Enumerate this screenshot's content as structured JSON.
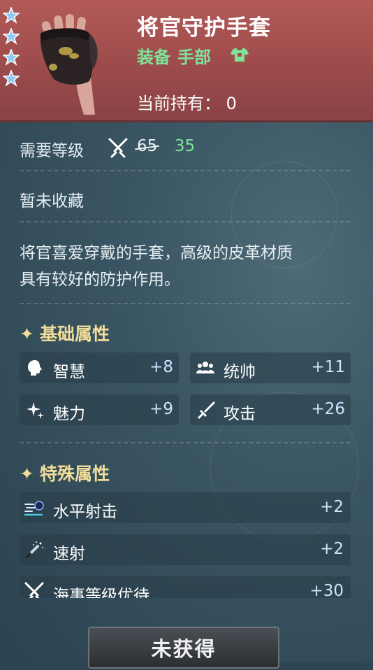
{
  "item": {
    "name": "将官守护手套",
    "category_label": "装备",
    "slot_label": "手部",
    "owned_label": "当前持有：",
    "owned_count": "0",
    "stars": 4,
    "colors": {
      "header": "#a24e4e",
      "accent_green": "#7fe39a",
      "gold": "#f1dc9a"
    }
  },
  "requirements": {
    "level_label": "需要等级",
    "level_original": "65",
    "level_current": "35",
    "collection_status": "暂未收藏"
  },
  "description": {
    "line1": "将官喜爱穿戴的手套，高级的皮革材质",
    "line2": "具有较好的防护作用。"
  },
  "basic_attributes": {
    "title": "基础属性",
    "items": [
      {
        "name": "智慧",
        "value": "+8",
        "icon": "head-icon"
      },
      {
        "name": "统帅",
        "value": "+11",
        "icon": "group-icon"
      },
      {
        "name": "魅力",
        "value": "+9",
        "icon": "sparkle-icon"
      },
      {
        "name": "攻击",
        "value": "+26",
        "icon": "sword-icon"
      }
    ]
  },
  "special_attributes": {
    "title": "特殊属性",
    "items": [
      {
        "name": "水平射击",
        "value": "+2",
        "icon": "horizontal-shot-icon"
      },
      {
        "name": "速射",
        "value": "+2",
        "icon": "rapid-fire-icon"
      },
      {
        "name": "海事等级优待",
        "value": "+30",
        "icon": "crossed-swords-icon"
      }
    ]
  },
  "action": {
    "label": "未获得"
  }
}
